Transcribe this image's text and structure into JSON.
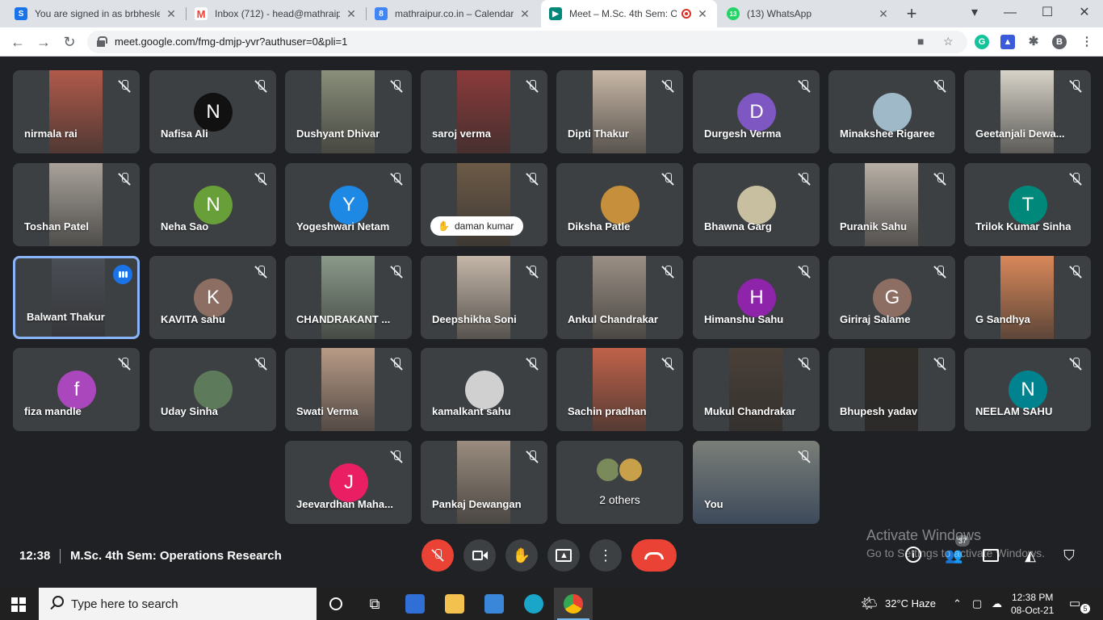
{
  "browser": {
    "tabs": [
      {
        "title": "You are signed in as brbhesle",
        "favicon": "S",
        "color": "#1a73e8"
      },
      {
        "title": "Inbox (712) - head@mathraip",
        "favicon": "M",
        "color": "#ea4335"
      },
      {
        "title": "mathraipur.co.in – Calendar -",
        "favicon": "8",
        "color": "#4285f4"
      },
      {
        "title": "Meet – M.Sc. 4th Sem: Op",
        "favicon": "meet",
        "color": "#00897b"
      },
      {
        "title": "(13) WhatsApp",
        "favicon": "13",
        "color": "#25d366"
      }
    ],
    "new_tab": "+",
    "window": {
      "minimize": "—",
      "maximize": "☐",
      "close": "✕"
    },
    "url": "meet.google.com/fmg-dmjp-yvr?authuser=0&pli=1",
    "profile_initial": "B",
    "extension_g": "G"
  },
  "participants": [
    {
      "name": "nirmala rai",
      "type": "video",
      "bg": "#b05a4a"
    },
    {
      "name": "Nafisa Ali",
      "type": "avatar",
      "initial": "N",
      "color": "#111111"
    },
    {
      "name": "Dushyant Dhivar",
      "type": "video",
      "bg": "#8a8f7a"
    },
    {
      "name": "saroj verma",
      "type": "video",
      "bg": "#8b3a3a"
    },
    {
      "name": "Dipti Thakur",
      "type": "video",
      "bg": "#c9b8a6"
    },
    {
      "name": "Durgesh Verma",
      "type": "avatar",
      "initial": "D",
      "color": "#7e57c2"
    },
    {
      "name": "Minakshee Rigaree",
      "type": "avatar",
      "initial": "",
      "color": "#9fb9c9"
    },
    {
      "name": "Geetanjali Dewa...",
      "type": "video",
      "bg": "#d7d3c8"
    },
    {
      "name": "Toshan Patel",
      "type": "video",
      "bg": "#a8a29a"
    },
    {
      "name": "Neha Sao",
      "type": "avatar",
      "initial": "N",
      "color": "#689f38"
    },
    {
      "name": "Yogeshwari Netam",
      "type": "avatar",
      "initial": "Y",
      "color": "#1e88e5"
    },
    {
      "name": "daman kumar",
      "type": "video",
      "bg": "#6d5a47",
      "hand": true
    },
    {
      "name": "Diksha Patle",
      "type": "avatar",
      "initial": "",
      "color": "#c58f3b"
    },
    {
      "name": "Bhawna Garg",
      "type": "avatar",
      "initial": "",
      "color": "#c8bfa0"
    },
    {
      "name": "Puranik Sahu",
      "type": "video",
      "bg": "#b8b0a6"
    },
    {
      "name": "Trilok Kumar Sinha",
      "type": "avatar",
      "initial": "T",
      "color": "#00897b"
    },
    {
      "name": "Balwant Thakur",
      "type": "video",
      "bg": "#4a4e55",
      "speaking": true
    },
    {
      "name": "KAVITA sahu",
      "type": "avatar",
      "initial": "K",
      "color": "#8d6e63"
    },
    {
      "name": "CHANDRAKANT ...",
      "type": "video",
      "bg": "#8a9a8a"
    },
    {
      "name": "Deepshikha Soni",
      "type": "video",
      "bg": "#c4b6a8"
    },
    {
      "name": "Ankul Chandrakar",
      "type": "video",
      "bg": "#9a8f84"
    },
    {
      "name": "Himanshu Sahu",
      "type": "avatar",
      "initial": "H",
      "color": "#8e24aa"
    },
    {
      "name": "Giriraj Salame",
      "type": "avatar",
      "initial": "G",
      "color": "#8d6e63"
    },
    {
      "name": "G Sandhya",
      "type": "video",
      "bg": "#d9885a"
    },
    {
      "name": "fiza mandle",
      "type": "avatar",
      "initial": "f",
      "color": "#ab47bc"
    },
    {
      "name": "Uday Sinha",
      "type": "avatar",
      "initial": "",
      "color": "#5d7b5a"
    },
    {
      "name": "Swati Verma",
      "type": "video",
      "bg": "#b89a86"
    },
    {
      "name": "kamalkant sahu",
      "type": "avatar",
      "initial": "",
      "color": "#d0d0d0"
    },
    {
      "name": "Sachin pradhan",
      "type": "video",
      "bg": "#c0624a"
    },
    {
      "name": "Mukul Chandrakar",
      "type": "video",
      "bg": "#4a4038"
    },
    {
      "name": "Bhupesh yadav",
      "type": "video",
      "bg": "#2e2a26"
    },
    {
      "name": "NEELAM SAHU",
      "type": "avatar",
      "initial": "N",
      "color": "#00838f"
    },
    {
      "name": "Jeevardhan Maha...",
      "type": "avatar",
      "initial": "J",
      "color": "#e91e63"
    },
    {
      "name": "Pankaj Dewangan",
      "type": "video",
      "bg": "#9a8c7e"
    },
    {
      "name": "2 others",
      "type": "others"
    },
    {
      "name": "You",
      "type": "self",
      "bg": "#7a7e78"
    }
  ],
  "meeting": {
    "time": "12:38",
    "title": "M.Sc. 4th Sem: Operations Research",
    "people_count": "37"
  },
  "watermark": {
    "line1": "Activate Windows",
    "line2": "Go to Settings to activate Windows."
  },
  "taskbar": {
    "search_placeholder": "Type here to search",
    "weather": "32°C  Haze",
    "time": "12:38 PM",
    "date": "08-Oct-21",
    "notifications": "5"
  }
}
